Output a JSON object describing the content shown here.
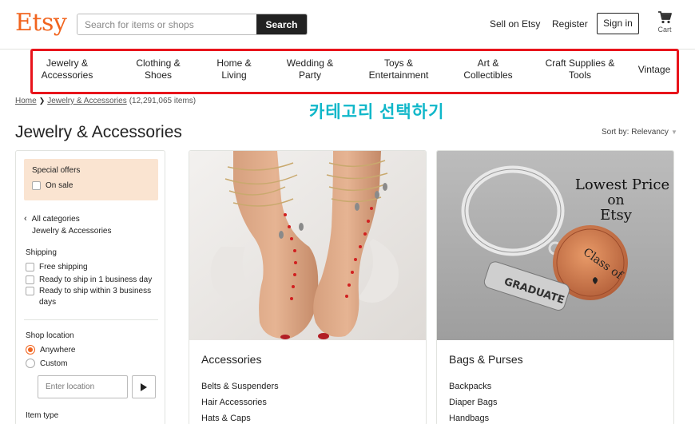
{
  "header": {
    "logo": "Etsy",
    "search_placeholder": "Search for items or shops",
    "search_button": "Search",
    "sell_link": "Sell on Etsy",
    "register_link": "Register",
    "signin_button": "Sign in",
    "cart_label": "Cart"
  },
  "nav": {
    "items": [
      {
        "line1": "Jewelry &",
        "line2": "Accessories"
      },
      {
        "line1": "Clothing &",
        "line2": "Shoes"
      },
      {
        "line1": "Home &",
        "line2": "Living"
      },
      {
        "line1": "Wedding &",
        "line2": "Party"
      },
      {
        "line1": "Toys &",
        "line2": "Entertainment"
      },
      {
        "line1": "Art &",
        "line2": "Collectibles"
      },
      {
        "line1": "Craft Supplies &",
        "line2": "Tools"
      },
      {
        "line1": "Vintage",
        "line2": ""
      }
    ],
    "highlight_color": "#e8141b"
  },
  "breadcrumb": {
    "home": "Home",
    "current": "Jewelry & Accessories",
    "count": "(12,291,065 items)"
  },
  "annotation": "카테고리 선택하기",
  "page_title": "Jewelry & Accessories",
  "sort": {
    "label": "Sort by: Relevancy"
  },
  "sidebar": {
    "special_offers": {
      "title": "Special offers",
      "on_sale": "On sale"
    },
    "all_categories": "All categories",
    "current_category": "Jewelry & Accessories",
    "shipping": {
      "title": "Shipping",
      "options": [
        "Free shipping",
        "Ready to ship in 1 business day",
        "Ready to ship within 3 business",
        "days"
      ]
    },
    "shop_location": {
      "title": "Shop location",
      "options": [
        "Anywhere",
        "Custom"
      ],
      "selected": "Anywhere",
      "input_placeholder": "Enter location"
    },
    "item_type": "Item type"
  },
  "cards": [
    {
      "title": "Accessories",
      "links": [
        "Belts & Suspenders",
        "Hair Accessories",
        "Hats & Caps"
      ]
    },
    {
      "title": "Bags & Purses",
      "links": [
        "Backpacks",
        "Diaper Bags",
        "Handbags"
      ],
      "image_text": {
        "line1": "Lowest Price",
        "line2": "on",
        "line3": "Etsy",
        "charm1": "GRADUATE",
        "charm2": "Class of"
      }
    }
  ],
  "colors": {
    "brand": "#f1641e",
    "annotation": "#10b7c9",
    "offers_bg": "#fae4d1"
  }
}
